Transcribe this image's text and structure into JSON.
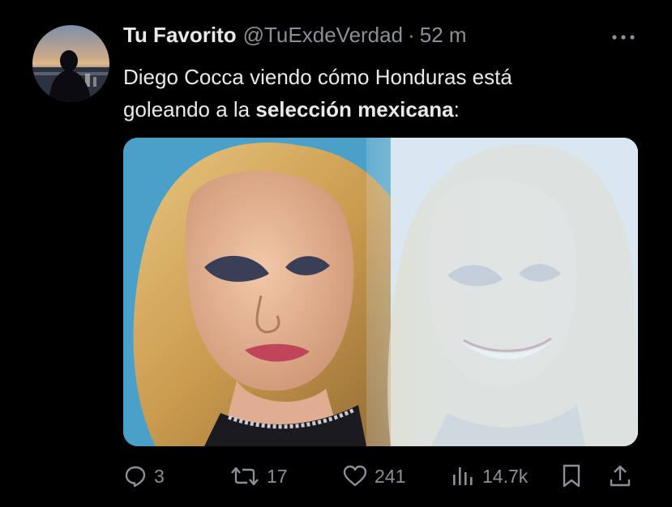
{
  "tweet": {
    "author": {
      "display_name": "Tu Favorito",
      "handle": "@TuExdeVerdad",
      "separator": "·",
      "time": "52 m"
    },
    "text": {
      "part1": "Diego Cocca viendo cómo Honduras está",
      "part2": "goleando a la ",
      "bold": "selección mexicana",
      "part3": ":"
    },
    "more_icon": "more-horizontal-icon",
    "media_description_icon": "photo"
  },
  "actions": {
    "reply": {
      "icon": "reply-bubble-icon",
      "count": "3"
    },
    "retweet": {
      "icon": "retweet-icon",
      "count": "17"
    },
    "like": {
      "icon": "heart-icon",
      "count": "241"
    },
    "views": {
      "icon": "bar-chart-icon",
      "count": "14.7k"
    },
    "bookmark": {
      "icon": "bookmark-icon"
    },
    "share": {
      "icon": "share-upload-icon"
    }
  },
  "colors": {
    "background": "#000000",
    "text_primary": "#e7e9ea",
    "text_secondary": "#8b9096"
  }
}
